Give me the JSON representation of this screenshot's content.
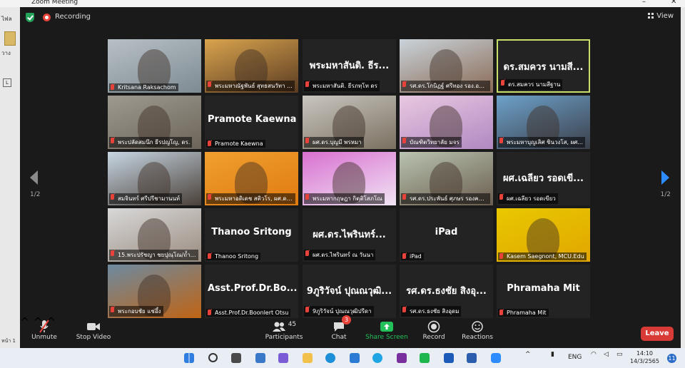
{
  "window": {
    "title": "Zoom Meeting"
  },
  "background_app": {
    "side_text": "ไฟล",
    "side_text2": "วาง",
    "page_text": "หน้า 1"
  },
  "topbar": {
    "recording_label": "Recording",
    "view_label": "View"
  },
  "pagination": {
    "left": "1/2",
    "right": "1/2"
  },
  "tiles": [
    {
      "label": "Kritsana Raksachom",
      "big": "",
      "video": true
    },
    {
      "label": "พระมหาณัฐพันธ์ สุทธสนวัทา ...",
      "big": "",
      "video": true
    },
    {
      "label": "พระมหาสันติ. ธีรภทฺโท ดร",
      "big": "พระมหาสันติ. ธีร...",
      "video": false
    },
    {
      "label": "รศ.ดร.โกนิฏฐ์ ศรีทอง รอง.อธิก...",
      "big": "",
      "video": true
    },
    {
      "label": "ดร.สมควร นามสีฐาน",
      "big": "ดร.สมควร นามสี...",
      "video": false,
      "active": true
    },
    {
      "label": "พระปลัดสมนึก ธีรปญโญ, ดร.",
      "big": "",
      "video": true
    },
    {
      "label": "Pramote Kaewna",
      "big": "Pramote Kaewna",
      "video": false
    },
    {
      "label": "ผศ.ดร.บุญมี พรหมา",
      "big": "",
      "video": true
    },
    {
      "label": "บัณฑิตวิทยาลัย มจร",
      "big": "",
      "video": true
    },
    {
      "label": "พระมหาบุญเลิศ ชินวงโส, ผศ...",
      "big": "",
      "video": true
    },
    {
      "label": "สมจินทร์ ศรีปรีชามานนท์",
      "big": "",
      "video": true
    },
    {
      "label": "พระมหาอดิเดช สติวโร, ผศ.ดร...",
      "big": "",
      "video": true
    },
    {
      "label": "พระมหากฤษฎา กิตฺติโสภโณ",
      "big": "",
      "video": true
    },
    {
      "label": "รศ.ดร.ประพันธ์ ศุภษร รองคณ...",
      "big": "",
      "video": true
    },
    {
      "label": "ผศ.เฉลียว รอดเขียว",
      "big": "ผศ.เฉลียว รอดเขี...",
      "video": false
    },
    {
      "label": "15.พระปรัชญา ชยปุณฺโณ/ถ้ำเม...",
      "big": "",
      "video": true
    },
    {
      "label": "Thanoo Sritong",
      "big": "Thanoo Sritong",
      "video": false
    },
    {
      "label": "ผศ.ดร.ไพรินทร์ ณ วันนา",
      "big": "ผศ.ดร.ไพรินทร์...",
      "video": false
    },
    {
      "label": "iPad",
      "big": "iPad",
      "video": false
    },
    {
      "label": "Kasem Saegnont, MCU.Edu",
      "big": "",
      "video": true
    },
    {
      "label": "พระกอบชัย แช่อึ้ง",
      "big": "",
      "video": true
    },
    {
      "label": "Asst.Prof.Dr.Boonlert Otsu",
      "big": "Asst.Prof.Dr.Bo...",
      "video": false
    },
    {
      "label": "9ภูริวัจน์ ปุณณวุฒิปรีดา",
      "big": "9ภูริวัจน์ ปุณณวุฒิ...",
      "video": false
    },
    {
      "label": "รศ.ดร.ธงชัย สิงอุดม",
      "big": "รศ.ดร.ธงชัย สิงอุ...",
      "video": false
    },
    {
      "label": "Phramaha Mit",
      "big": "Phramaha Mit",
      "video": false
    }
  ],
  "toolbar": {
    "unmute": "Unmute",
    "stop_video": "Stop Video",
    "participants": "Participants",
    "participants_count": "45",
    "chat": "Chat",
    "chat_badge": "3",
    "share_screen": "Share Screen",
    "record": "Record",
    "reactions": "Reactions",
    "leave": "Leave"
  },
  "taskbar": {
    "lang": "ENG",
    "time": "14:10",
    "date": "14/3/2565",
    "notifications": "11"
  },
  "colors": {
    "active_speaker": "#c8e06a",
    "leave": "#d83a35",
    "share": "#23c15a",
    "accent": "#2d8cff"
  }
}
